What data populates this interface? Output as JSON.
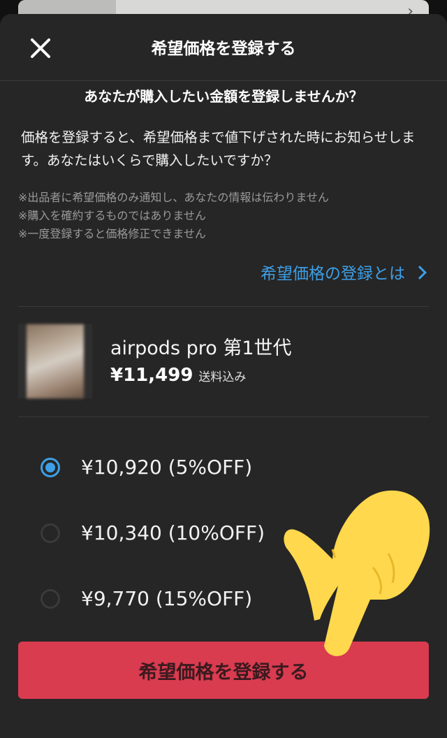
{
  "header": {
    "title": "希望価格を登録する"
  },
  "lead": "あなたが購入したい金額を登録しませんか？",
  "description": "価格を登録すると、希望価格まで値下げされた時にお知らせします。あなたはいくらで購入したいですか？",
  "notes": [
    "※出品者に希望価格のみ通知し、あなたの情報は伝わりません",
    "※購入を確約するものではありません",
    "※一度登録すると価格修正できません"
  ],
  "about_link": "希望価格の登録とは",
  "product": {
    "name": "airpods pro 第1世代",
    "price": "¥11,499",
    "shipping": "送料込み"
  },
  "options": [
    {
      "label": "¥10,920 (5%OFF)",
      "selected": true
    },
    {
      "label": "¥10,340 (10%OFF)",
      "selected": false
    },
    {
      "label": "¥9,770 (15%OFF)",
      "selected": false
    }
  ],
  "submit_label": "希望価格を登録する",
  "colors": {
    "accent": "#3e9fe6",
    "button": "#d93b4f",
    "sheet": "#262626",
    "hand": "#ffd84d"
  },
  "icons": [
    "close-icon",
    "chevron-right-icon",
    "pointing-hand-icon"
  ]
}
